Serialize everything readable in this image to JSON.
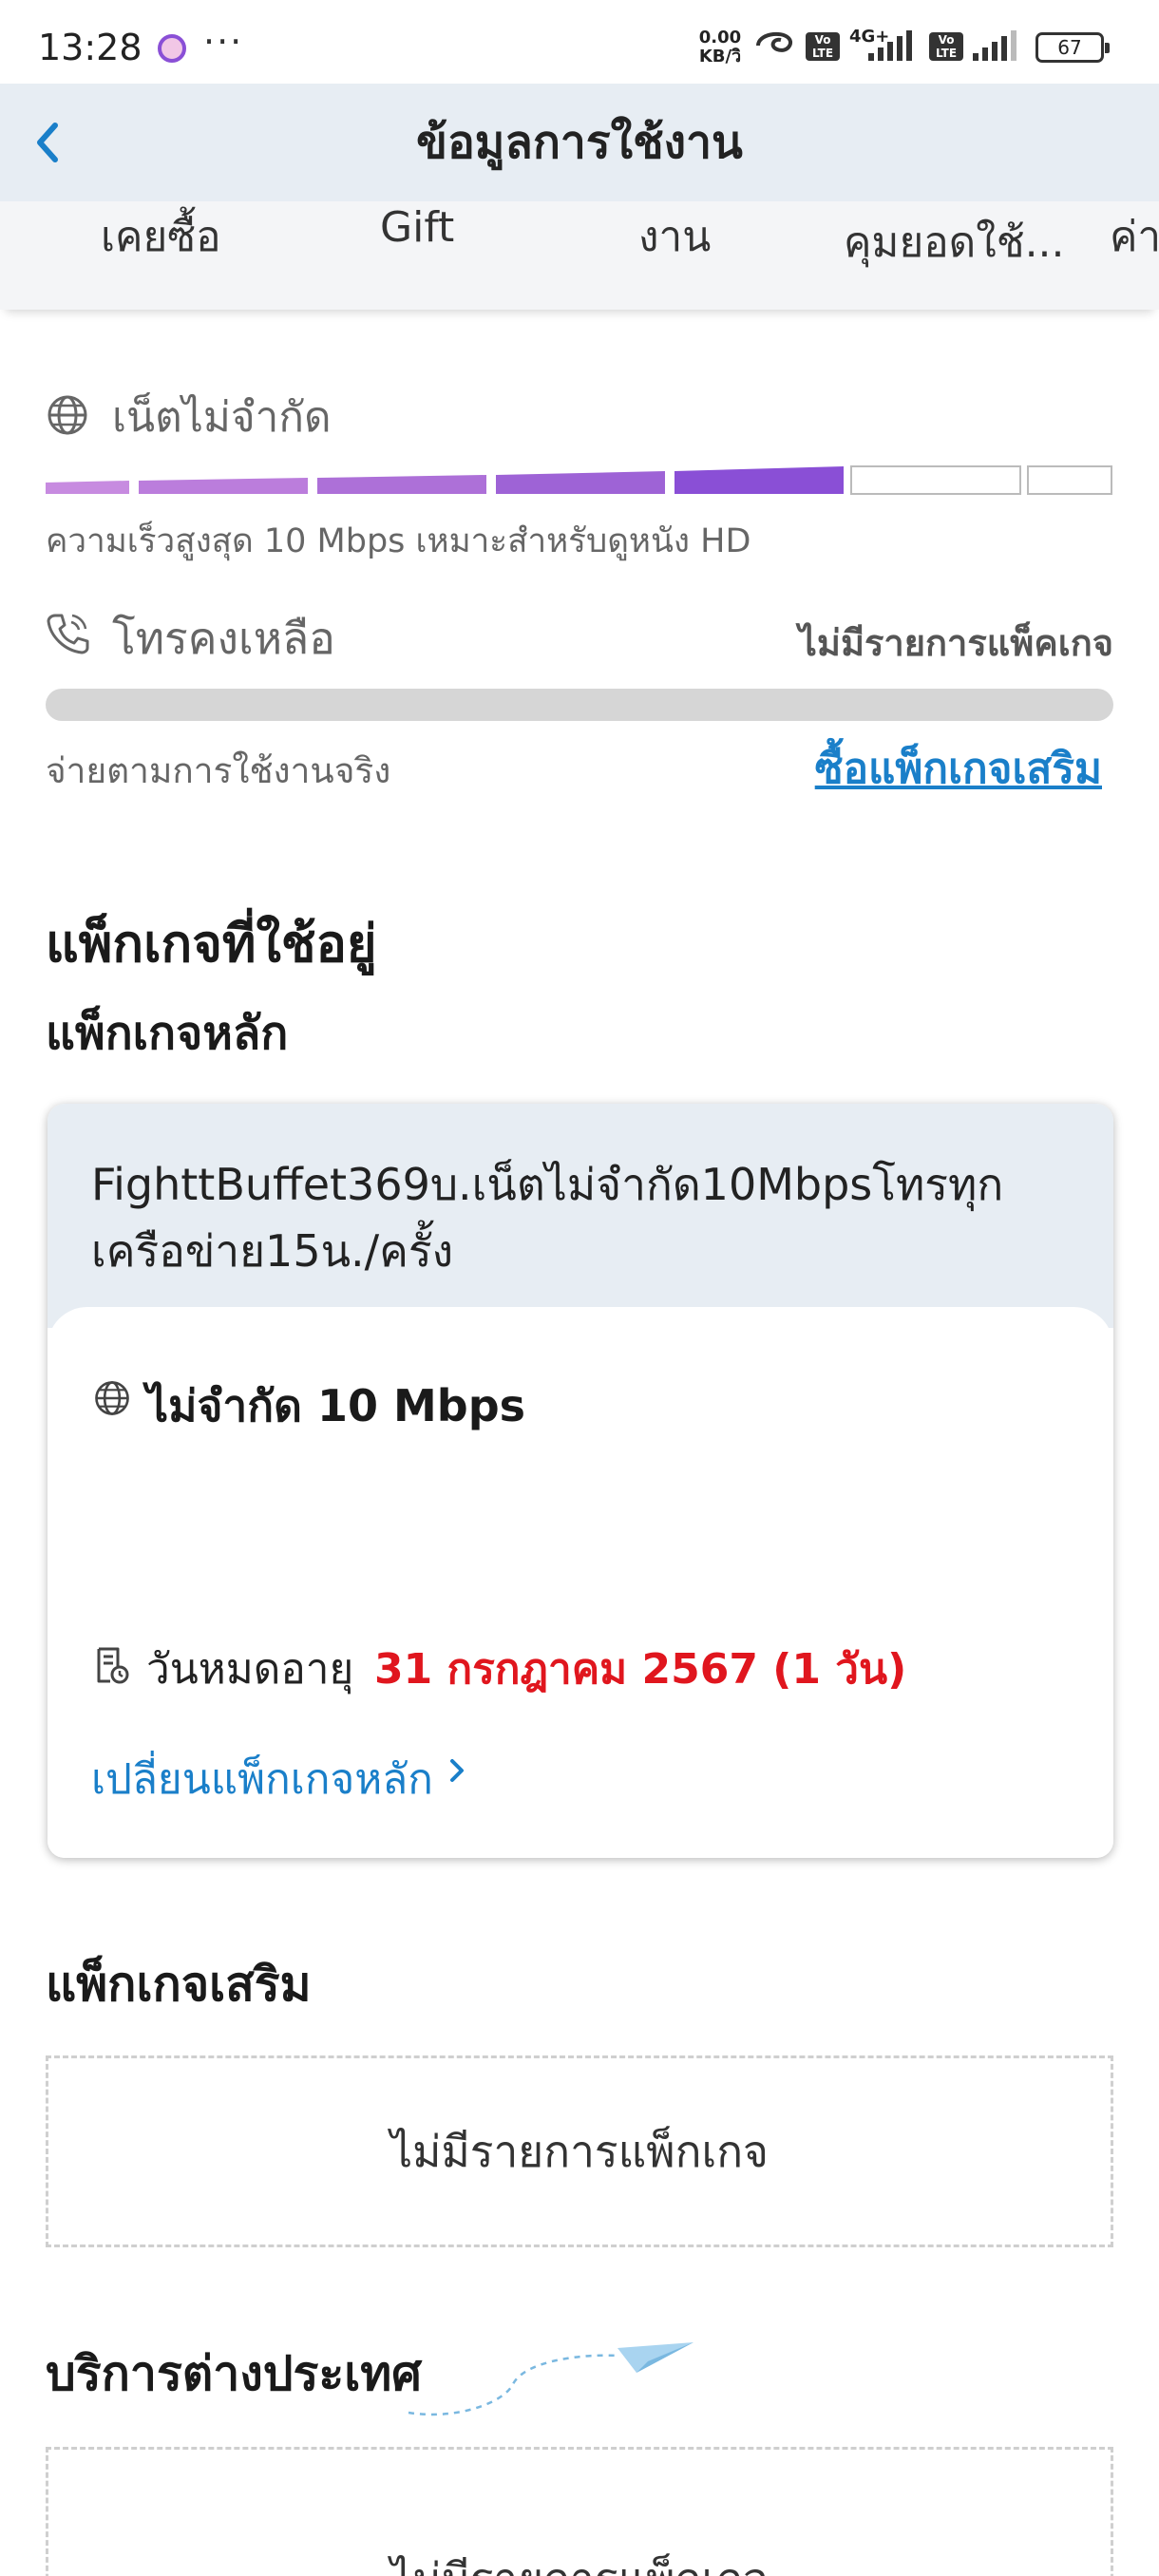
{
  "status_bar": {
    "time": "13:28",
    "net_speed_value": "0.00",
    "net_speed_unit": "KB/วิ",
    "volte_label": "Vo\nLTE",
    "network_type": "4G+",
    "battery": "67"
  },
  "header": {
    "title": "ข้อมูลการใช้งาน"
  },
  "tabs": [
    {
      "label": "เคยซื้อ"
    },
    {
      "label": "Gift"
    },
    {
      "label": "งาน"
    },
    {
      "label": "คุมยอดใช้..."
    },
    {
      "label": "ค่าบ"
    }
  ],
  "internet": {
    "label": "เน็ตไม่จำกัด",
    "description": "ความเร็วสูงสุด 10 Mbps เหมาะสำหรับดูหนัง HD",
    "active_segments": 5,
    "total_segments": 7
  },
  "calls": {
    "label": "โทรคงเหลือ",
    "status": "ไม่มีรายการแพ็คเกจ",
    "pay_text": "จ่ายตามการใช้งานจริง",
    "buy_link": "ซื้อแพ็กเกจเสริม"
  },
  "packages": {
    "current_heading": "แพ็กเกจที่ใช้อยู่",
    "main_heading": "แพ็กเกจหลัก",
    "main_package": {
      "name": "FighttBuffet369บ.เน็ตไม่จำกัด10Mbpsโทรทุกเครือข่าย15น./ครั้ง",
      "speed": "ไม่จำกัด 10 Mbps",
      "expiry_label": "วันหมดอายุ",
      "expiry_value": "31 กรกฎาคม 2567 (1 วัน)",
      "change_link": "เปลี่ยนแพ็กเกจหลัก"
    },
    "addon_heading": "แพ็กเกจเสริม",
    "addon_empty": "ไม่มีรายการแพ็กเกจ",
    "intl_heading": "บริการต่างประเทศ",
    "intl_empty": "ไม่มีรายการแพ็กเกจ"
  },
  "colors": {
    "accent_link": "#1a7fc9",
    "expiry_red": "#e0161e",
    "header_bg": "#e7edf3",
    "bar_purple": "#8a4fd6"
  }
}
